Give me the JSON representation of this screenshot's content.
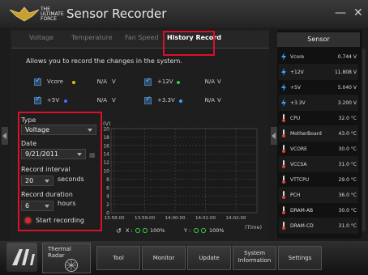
{
  "app": {
    "title": "Sensor Recorder",
    "logo_text": [
      "THE",
      "ULTIMATE",
      "FORCE"
    ]
  },
  "colors": {
    "highlight": "#d8102a",
    "vcore_dot": "#e0c000",
    "v12_dot": "#2ecc40",
    "v5_dot": "#4a6cff",
    "v33_dot": "#3aa0ff"
  },
  "tabs": [
    {
      "label": "Voltage",
      "active": false
    },
    {
      "label": "Temperature",
      "active": false
    },
    {
      "label": "Fan Speed",
      "active": false
    },
    {
      "label": "History Record",
      "active": true
    }
  ],
  "description": "Allows you to record the changes in the system.",
  "config": [
    {
      "label": "Vcore",
      "value": "N/A",
      "unit": "V"
    },
    {
      "label": "+12V",
      "value": "N/A",
      "unit": "V"
    },
    {
      "label": "+5V",
      "value": "N/A",
      "unit": "V"
    },
    {
      "label": "+3.3V",
      "value": "N/A",
      "unit": "V"
    }
  ],
  "panel": {
    "type_label": "Type",
    "type_value": "Voltage",
    "date_label": "Date",
    "date_value": "9/21/2011",
    "interval_label": "Record interval",
    "interval_value": "20",
    "interval_unit": "seconds",
    "duration_label": "Record duration",
    "duration_value": "6",
    "duration_unit": "hours",
    "start_label": "Start recording"
  },
  "chart_data": {
    "type": "line",
    "ylabel": "(V)",
    "xlabel": "(Time)",
    "yticks": [
      "20",
      "18",
      "16",
      "14",
      "12",
      "10",
      "8",
      "6",
      "4",
      "2",
      "0"
    ],
    "ylim": [
      0,
      20
    ],
    "xticks": [
      "13:58:00",
      "13:59:00",
      "14:00:00",
      "14:01:00",
      "14:02:00"
    ],
    "series": [],
    "zoom_x": "100%",
    "zoom_y": "100%",
    "zoom_x_label": "X :",
    "zoom_y_label": "Y :"
  },
  "sensor": {
    "title": "Sensor",
    "rows": [
      {
        "name": "Vcore",
        "value": "0.744 V",
        "icon": "lightning-icon"
      },
      {
        "name": "+12V",
        "value": "11.808 V",
        "icon": "lightning-icon"
      },
      {
        "name": "+5V",
        "value": "5.040 V",
        "icon": "lightning-icon"
      },
      {
        "name": "+3.3V",
        "value": "3.200 V",
        "icon": "lightning-icon"
      },
      {
        "name": "CPU",
        "value": "32.0 °C",
        "icon": "thermometer-icon"
      },
      {
        "name": "MotherBoard",
        "value": "43.0 °C",
        "icon": "thermometer-icon"
      },
      {
        "name": "VCORE",
        "value": "30.0 °C",
        "icon": "thermometer-icon"
      },
      {
        "name": "VCCSA",
        "value": "31.0 °C",
        "icon": "thermometer-icon"
      },
      {
        "name": "VTTCPU",
        "value": "29.0 °C",
        "icon": "thermometer-icon"
      },
      {
        "name": "PCH",
        "value": "36.0 °C",
        "icon": "thermometer-icon"
      },
      {
        "name": "DRAM-AB",
        "value": "30.0 °C",
        "icon": "thermometer-icon"
      },
      {
        "name": "DRAM-CD",
        "value": "31.0 °C",
        "icon": "thermometer-icon"
      }
    ]
  },
  "taskbar": {
    "thermal_radar": "Thermal Radar",
    "items": [
      "Tool",
      "Monitor",
      "Update",
      "System Information",
      "Settings"
    ]
  }
}
